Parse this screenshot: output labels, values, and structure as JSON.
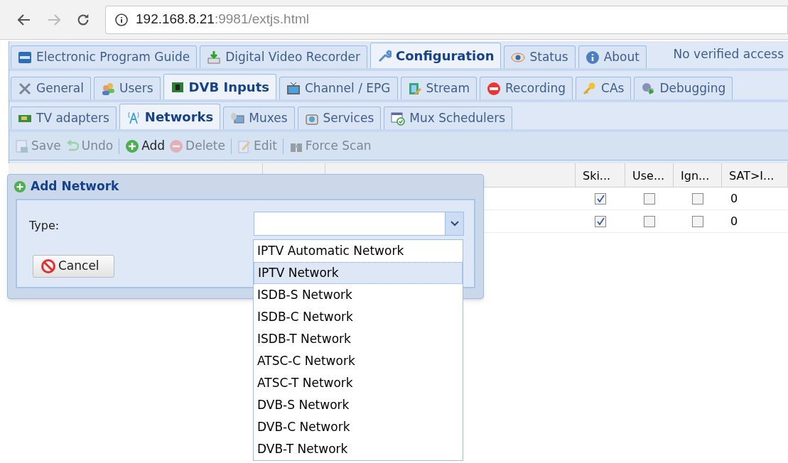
{
  "browser": {
    "url_host": "192.168.8.21",
    "url_rest": ":9981/extjs.html"
  },
  "main_tabs": [
    {
      "label": "Electronic Program Guide",
      "selected": false
    },
    {
      "label": "Digital Video Recorder",
      "selected": false
    },
    {
      "label": "Configuration",
      "selected": true
    },
    {
      "label": "Status",
      "selected": false
    },
    {
      "label": "About",
      "selected": false
    }
  ],
  "access_notice": "No verified access",
  "config_tabs": [
    {
      "label": "General",
      "selected": false
    },
    {
      "label": "Users",
      "selected": false
    },
    {
      "label": "DVB Inputs",
      "selected": true
    },
    {
      "label": "Channel / EPG",
      "selected": false
    },
    {
      "label": "Stream",
      "selected": false
    },
    {
      "label": "Recording",
      "selected": false
    },
    {
      "label": "CAs",
      "selected": false
    },
    {
      "label": "Debugging",
      "selected": false
    }
  ],
  "input_tabs": [
    {
      "label": "TV adapters",
      "selected": false
    },
    {
      "label": "Networks",
      "selected": true
    },
    {
      "label": "Muxes",
      "selected": false
    },
    {
      "label": "Services",
      "selected": false
    },
    {
      "label": "Mux Schedulers",
      "selected": false
    }
  ],
  "toolbar": [
    {
      "label": "Save",
      "disabled": true,
      "separator_after": false
    },
    {
      "label": "Undo",
      "disabled": true,
      "separator_after": true
    },
    {
      "label": "Add",
      "disabled": false,
      "separator_after": false
    },
    {
      "label": "Delete",
      "disabled": true,
      "separator_after": true
    },
    {
      "label": "Edit",
      "disabled": true,
      "separator_after": true
    },
    {
      "label": "Force Scan",
      "disabled": true,
      "separator_after": false
    }
  ],
  "table": {
    "columns": [
      "Ski...",
      "Use...",
      "Ign...",
      "SAT>I..."
    ],
    "rows": [
      {
        "skip": true,
        "use": false,
        "ignore": false,
        "sat": "0"
      },
      {
        "skip": true,
        "use": false,
        "ignore": false,
        "sat": "0"
      }
    ]
  },
  "dialog": {
    "title": "Add Network",
    "type_label": "Type:",
    "cancel": "Cancel",
    "options": [
      {
        "label": "IPTV Automatic Network",
        "selected": false
      },
      {
        "label": "IPTV Network",
        "selected": true
      },
      {
        "label": "ISDB-S Network",
        "selected": false
      },
      {
        "label": "ISDB-C Network",
        "selected": false
      },
      {
        "label": "ISDB-T Network",
        "selected": false
      },
      {
        "label": "ATSC-C Network",
        "selected": false
      },
      {
        "label": "ATSC-T Network",
        "selected": false
      },
      {
        "label": "DVB-S Network",
        "selected": false
      },
      {
        "label": "DVB-C Network",
        "selected": false
      },
      {
        "label": "DVB-T Network",
        "selected": false
      }
    ]
  }
}
